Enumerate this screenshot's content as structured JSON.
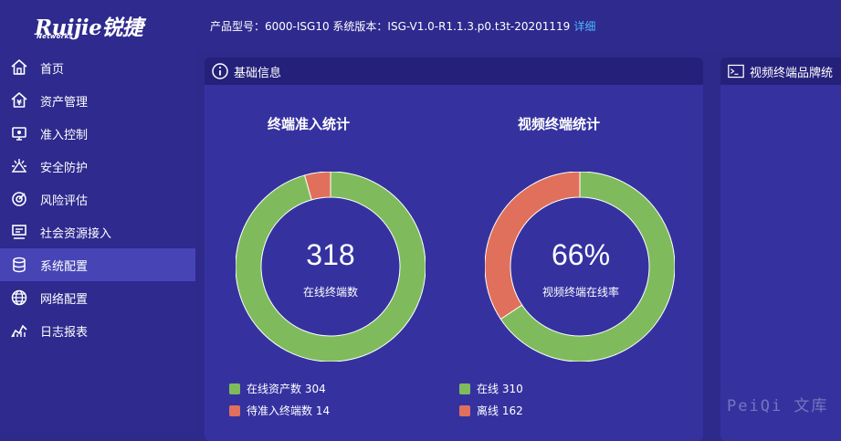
{
  "header": {
    "logo_text": "Ruijie锐捷",
    "logo_sub": "Networks",
    "product_info": "产品型号：6000-ISG10 系统版本：ISG-V1.0-R1.1.3.p0.t3t-20201119",
    "detail_link": "详细"
  },
  "sidebar": {
    "items": [
      {
        "label": "首页",
        "icon": "home-icon"
      },
      {
        "label": "资产管理",
        "icon": "asset-icon"
      },
      {
        "label": "准入控制",
        "icon": "access-control-icon"
      },
      {
        "label": "安全防护",
        "icon": "security-icon"
      },
      {
        "label": "风险评估",
        "icon": "risk-icon"
      },
      {
        "label": "社会资源接入",
        "icon": "social-resource-icon"
      },
      {
        "label": "系统配置",
        "icon": "system-config-icon",
        "active": true
      },
      {
        "label": "网络配置",
        "icon": "network-icon"
      },
      {
        "label": "日志报表",
        "icon": "report-icon"
      }
    ]
  },
  "panels": {
    "basic_info": {
      "title": "基础信息"
    },
    "video_brand": {
      "title": "视频终端品牌统"
    }
  },
  "colors": {
    "green": "#7fbb5c",
    "red": "#e0705b",
    "active_nav": "#4745b6",
    "background": "#2d2a8c"
  },
  "chart_data": [
    {
      "type": "pie",
      "title": "终端准入统计",
      "center_value": "318",
      "center_label": "在线终端数",
      "slices": [
        {
          "label": "在线资产数 304",
          "name": "在线资产数",
          "value": 304,
          "color": "#7fbb5c"
        },
        {
          "label": "待准入终端数 14",
          "name": "待准入终端数",
          "value": 14,
          "color": "#e0705b"
        }
      ]
    },
    {
      "type": "pie",
      "title": "视频终端统计",
      "center_value": "66%",
      "center_label": "视频终端在线率",
      "slices": [
        {
          "label": "在线 310",
          "name": "在线",
          "value": 310,
          "color": "#7fbb5c"
        },
        {
          "label": "离线 162",
          "name": "离线",
          "value": 162,
          "color": "#e0705b"
        }
      ]
    }
  ],
  "watermark": "PeiQi 文库"
}
